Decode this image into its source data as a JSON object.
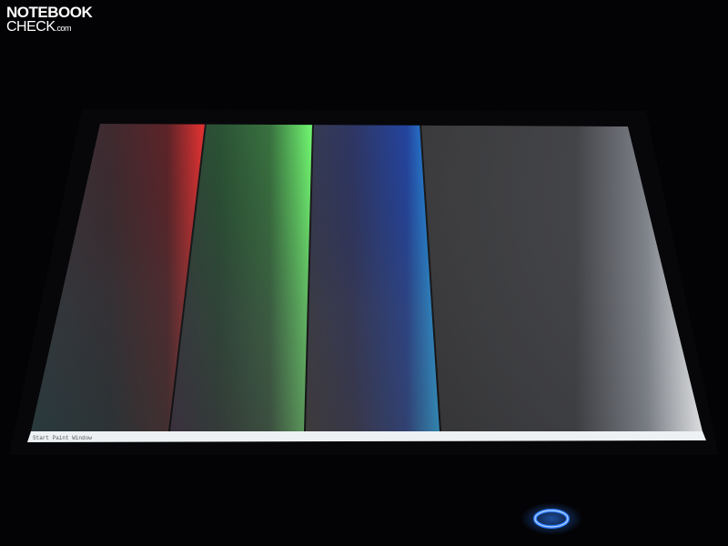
{
  "watermark": {
    "line1": "NOTEBOOK",
    "line2": "CHECK",
    "domain": ".com"
  },
  "screen": {
    "taskbar_text": "Start Paint Window",
    "stripes": [
      {
        "name": "red-gradient",
        "accent": "#ff3a3a"
      },
      {
        "name": "green-gradient",
        "accent": "#6cff6c"
      },
      {
        "name": "blue-gradient",
        "accent": "#1f9bff"
      },
      {
        "name": "gray-gradient",
        "accent": "#f2f4f6"
      }
    ]
  },
  "power_indicator": {
    "color": "#2f7dff",
    "state": "on"
  }
}
